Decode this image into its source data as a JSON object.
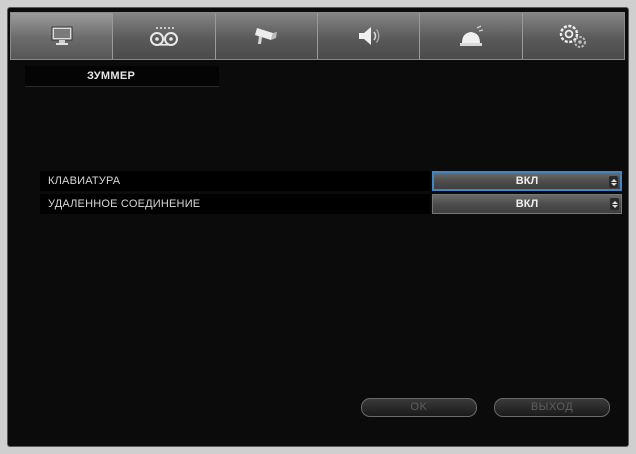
{
  "tabs": [
    {
      "icon": "monitor-icon"
    },
    {
      "icon": "recording-icon"
    },
    {
      "icon": "camera-icon"
    },
    {
      "icon": "speaker-icon"
    },
    {
      "icon": "alarm-bell-icon"
    },
    {
      "icon": "settings-gears-icon"
    }
  ],
  "section": {
    "title": "ЗУММЕР"
  },
  "settings": [
    {
      "label": "КЛАВИАТУРА",
      "value": "ВКЛ"
    },
    {
      "label": "УДАЛЕННОЕ СОЕДИНЕНИЕ",
      "value": "ВКЛ"
    }
  ],
  "buttons": {
    "ok": "OK",
    "exit": "ВЫХОД"
  },
  "colors": {
    "focus": "#3f86c9",
    "background": "#0b0b0b"
  }
}
